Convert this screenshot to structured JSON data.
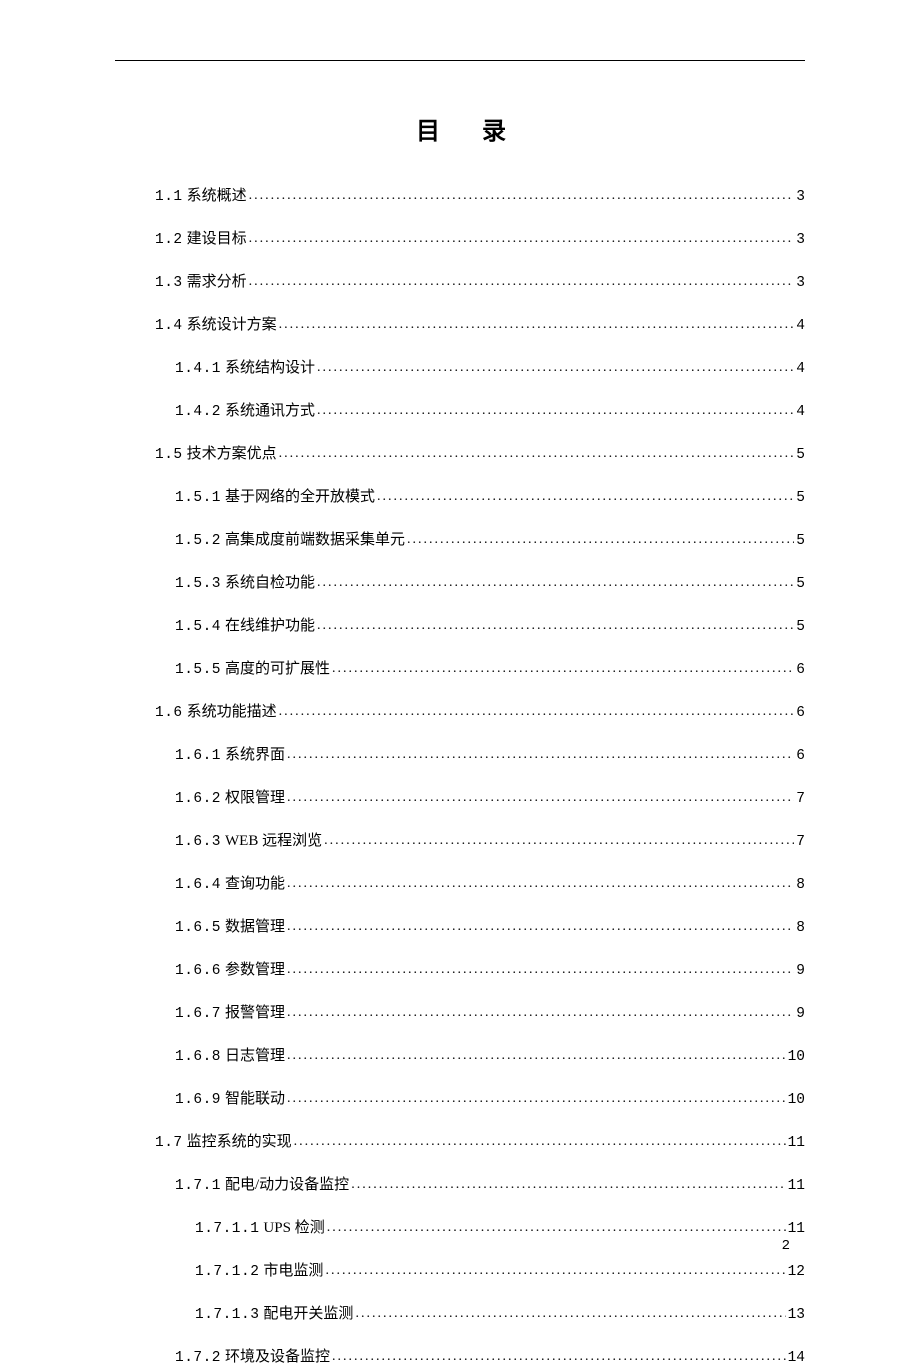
{
  "title": "目 录",
  "entries": [
    {
      "level": 1,
      "num": "1.1",
      "label": "系统概述",
      "page": "3"
    },
    {
      "level": 1,
      "num": "1.2",
      "label": "建设目标",
      "page": "3"
    },
    {
      "level": 1,
      "num": "1.3",
      "label": "需求分析",
      "page": "3"
    },
    {
      "level": 1,
      "num": "1.4",
      "label": "系统设计方案",
      "page": "4"
    },
    {
      "level": 2,
      "num": "1.4.1",
      "label": "系统结构设计",
      "page": "4"
    },
    {
      "level": 2,
      "num": "1.4.2",
      "label": "系统通讯方式",
      "page": "4"
    },
    {
      "level": 1,
      "num": "1.5",
      "label": "技术方案优点",
      "page": "5"
    },
    {
      "level": 2,
      "num": "1.5.1",
      "label": "基于网络的全开放模式",
      "page": "5"
    },
    {
      "level": 2,
      "num": "1.5.2",
      "label": "高集成度前端数据采集单元",
      "page": "5"
    },
    {
      "level": 2,
      "num": "1.5.3",
      "label": "系统自检功能",
      "page": "5"
    },
    {
      "level": 2,
      "num": "1.5.4",
      "label": "在线维护功能",
      "page": "5"
    },
    {
      "level": 2,
      "num": "1.5.5",
      "label": "高度的可扩展性",
      "page": "6"
    },
    {
      "level": 1,
      "num": "1.6",
      "label": "系统功能描述",
      "page": "6"
    },
    {
      "level": 2,
      "num": "1.6.1",
      "label": "系统界面",
      "page": "6"
    },
    {
      "level": 2,
      "num": "1.6.2",
      "label": "权限管理",
      "page": "7"
    },
    {
      "level": 2,
      "num": "1.6.3",
      "label": "WEB 远程浏览",
      "page": "7"
    },
    {
      "level": 2,
      "num": "1.6.4",
      "label": "查询功能",
      "page": "8"
    },
    {
      "level": 2,
      "num": "1.6.5",
      "label": "数据管理",
      "page": "8"
    },
    {
      "level": 2,
      "num": "1.6.6",
      "label": "参数管理",
      "page": "9"
    },
    {
      "level": 2,
      "num": "1.6.7",
      "label": "报警管理",
      "page": "9"
    },
    {
      "level": 2,
      "num": "1.6.8",
      "label": "日志管理",
      "page": "10"
    },
    {
      "level": 2,
      "num": "1.6.9",
      "label": "智能联动",
      "page": "10"
    },
    {
      "level": 1,
      "num": "1.7",
      "label": "监控系统的实现",
      "page": "11"
    },
    {
      "level": 2,
      "num": "1.7.1",
      "label": "配电/动力设备监控",
      "page": "11"
    },
    {
      "level": 3,
      "num": "1.7.1.1",
      "label": "UPS 检测",
      "page": "11"
    },
    {
      "level": 3,
      "num": "1.7.1.2",
      "label": "市电监测",
      "page": "12"
    },
    {
      "level": 3,
      "num": "1.7.1.3",
      "label": "配电开关监测",
      "page": "13"
    },
    {
      "level": 2,
      "num": "1.7.2",
      "label": "环境及设备监控",
      "page": "14"
    }
  ],
  "footerPage": "2"
}
